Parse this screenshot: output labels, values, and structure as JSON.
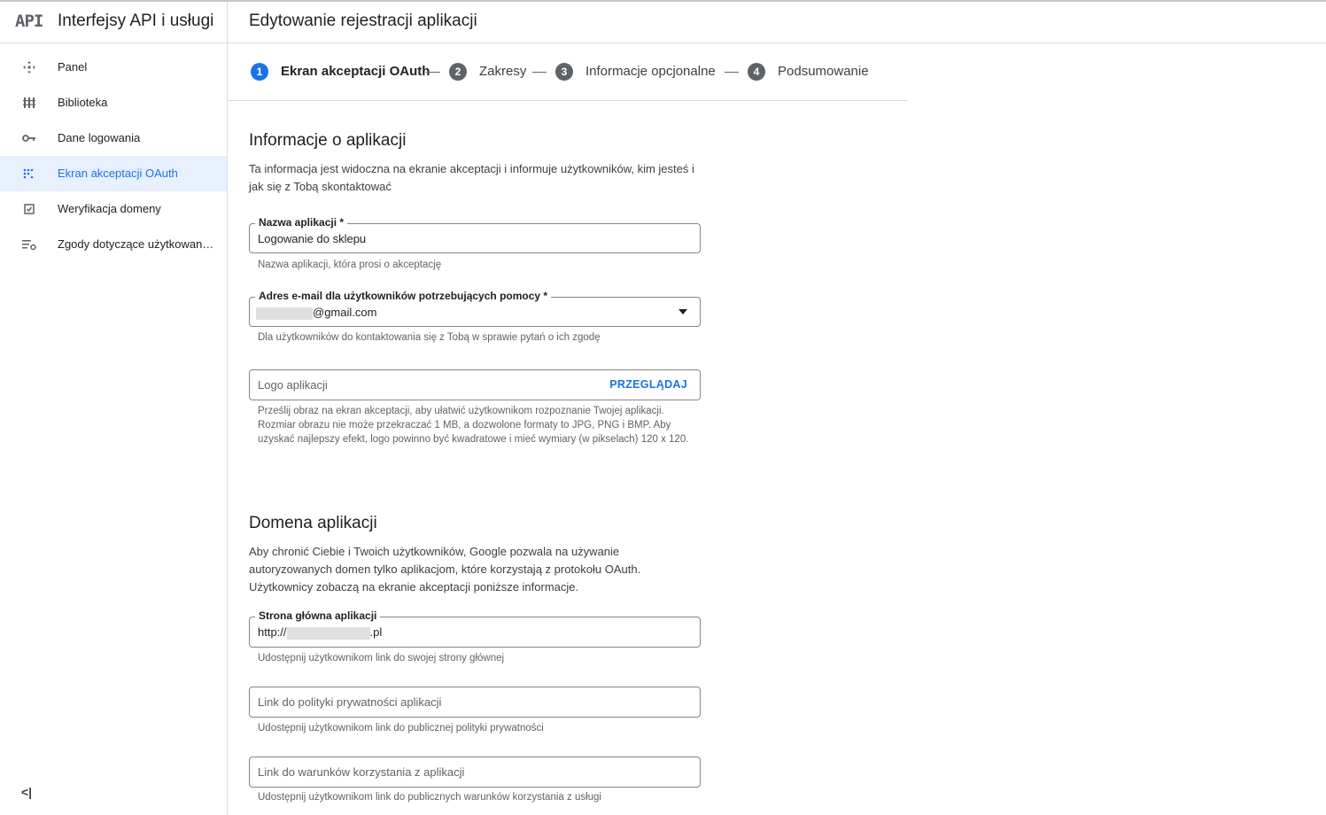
{
  "brand": {
    "logo": "API",
    "title": "Interfejsy API i usługi"
  },
  "nav": {
    "items": [
      {
        "label": "Panel",
        "icon": "dashboard-icon"
      },
      {
        "label": "Biblioteka",
        "icon": "library-icon"
      },
      {
        "label": "Dane logowania",
        "icon": "key-icon"
      },
      {
        "label": "Ekran akceptacji OAuth",
        "icon": "oauth-consent-icon",
        "active": true
      },
      {
        "label": "Weryfikacja domeny",
        "icon": "checkbox-icon"
      },
      {
        "label": "Zgody dotyczące użytkowan…",
        "icon": "settings-list-icon"
      }
    ],
    "collapse": "<|"
  },
  "header": {
    "title": "Edytowanie rejestracji aplikacji"
  },
  "stepper": {
    "steps": [
      {
        "num": "1",
        "label": "Ekran akceptacji OAuth",
        "active": true
      },
      {
        "num": "2",
        "label": "Zakresy"
      },
      {
        "num": "3",
        "label": "Informacje opcjonalne"
      },
      {
        "num": "4",
        "label": "Podsumowanie"
      }
    ]
  },
  "app_info": {
    "title": "Informacje o aplikacji",
    "description": "Ta informacja jest widoczna na ekranie akceptacji i informuje użytkowników, kim jesteś i jak się z Tobą skontaktować",
    "app_name": {
      "label": "Nazwa aplikacji *",
      "value": "Logowanie do sklepu",
      "hint": "Nazwa aplikacji, która prosi o akceptację"
    },
    "support_email": {
      "label": "Adres e-mail dla użytkowników potrzebujących pomocy *",
      "value": "@gmail.com",
      "hint": "Dla użytkowników do kontaktowania się z Tobą w sprawie pytań o ich zgodę"
    },
    "logo": {
      "placeholder": "Logo aplikacji",
      "browse": "PRZEGLĄDAJ",
      "hint": "Prześlij obraz na ekran akceptacji, aby ułatwić użytkownikom rozpoznanie Twojej aplikacji. Rozmiar obrazu nie może przekraczać 1 MB, a dozwolone formaty to JPG, PNG i BMP. Aby uzyskać najlepszy efekt, logo powinno być kwadratowe i mieć wymiary (w pikselach) 120 x 120."
    }
  },
  "app_domain": {
    "title": "Domena aplikacji",
    "description": "Aby chronić Ciebie i Twoich użytkowników, Google pozwala na używanie autoryzowanych domen tylko aplikacjom, które korzystają z protokołu OAuth. Użytkownicy zobaczą na ekranie akceptacji poniższe informacje.",
    "homepage": {
      "label": "Strona główna aplikacji",
      "prefix": "http://",
      "suffix": ".pl",
      "hint": "Udostępnij użytkownikom link do swojej strony głównej"
    },
    "privacy": {
      "placeholder": "Link do polityki prywatności aplikacji",
      "hint": "Udostępnij użytkownikom link do publicznej polityki prywatności"
    },
    "terms": {
      "placeholder": "Link do warunków korzystania z aplikacji",
      "hint": "Udostępnij użytkownikom link do publicznych warunków korzystania z usługi"
    }
  },
  "colors": {
    "accent": "#1a73e8",
    "active_bg": "#e8f0fe",
    "border": "#dadce0"
  }
}
